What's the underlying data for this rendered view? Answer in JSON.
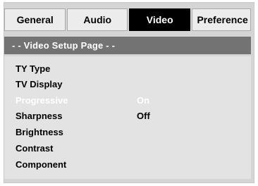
{
  "tabs": [
    {
      "label": "General",
      "active": false
    },
    {
      "label": "Audio",
      "active": false
    },
    {
      "label": "Video",
      "active": true
    },
    {
      "label": "Preference",
      "active": false
    }
  ],
  "page_title": "- -  Video Setup Page  - -",
  "menu": [
    {
      "label": "TY Type",
      "value": ""
    },
    {
      "label": "TV Display",
      "value": ""
    },
    {
      "label": "Progressive",
      "value": "On",
      "highlighted": true
    },
    {
      "label": "Sharpness",
      "value": "Off"
    },
    {
      "label": "Brightness",
      "value": ""
    },
    {
      "label": "Contrast",
      "value": ""
    },
    {
      "label": "Component",
      "value": ""
    }
  ],
  "colors": {
    "tab_active_bg": "#000000",
    "tab_inactive_bg": "#ececec",
    "page_bar_bg": "#737373",
    "panel_bg": "#e3e3e3",
    "highlight_text": "#ffffff"
  }
}
